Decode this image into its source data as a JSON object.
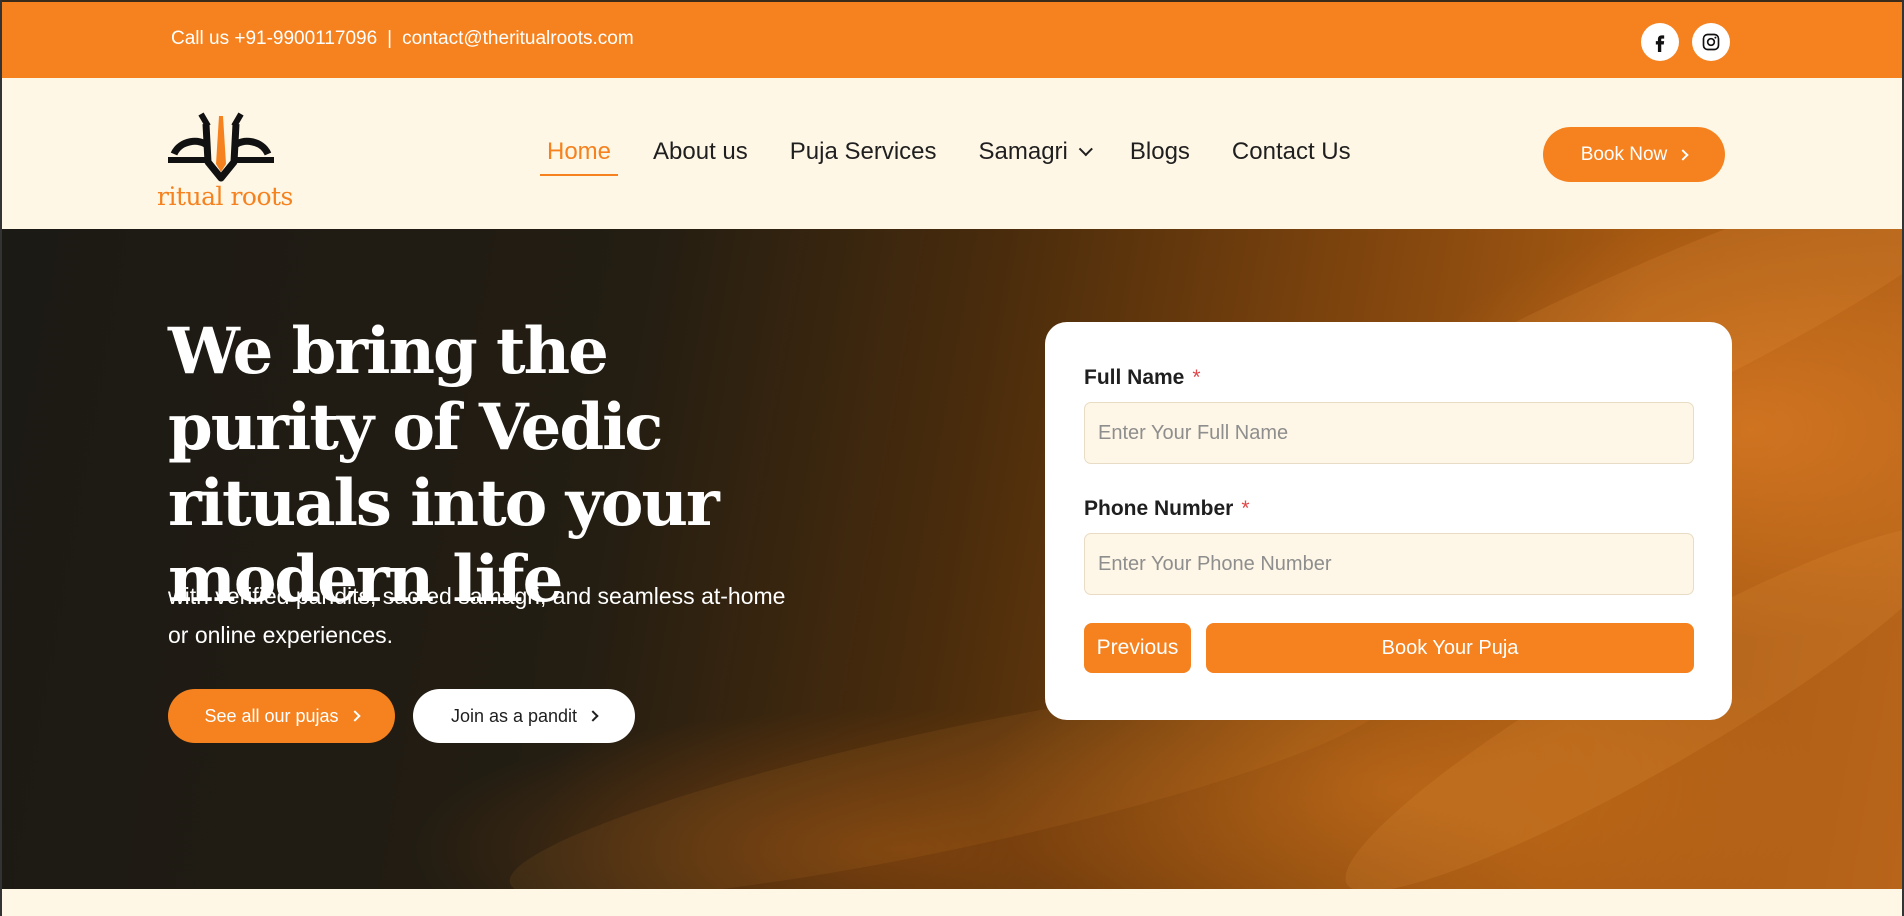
{
  "topbar": {
    "phone_text": "Call us +91-9900117096",
    "separator": "|",
    "email_text": "contact@theritualroots.com",
    "social_icons": [
      "facebook-icon",
      "instagram-icon"
    ]
  },
  "header": {
    "logo_text": "ritual roots",
    "nav": [
      {
        "label": "Home",
        "active": true
      },
      {
        "label": "About us",
        "active": false
      },
      {
        "label": "Puja Services",
        "active": false
      },
      {
        "label": "Samagri",
        "active": false,
        "has_dropdown": true
      },
      {
        "label": "Blogs",
        "active": false
      },
      {
        "label": "Contact Us",
        "active": false
      }
    ],
    "cta_label": "Book Now"
  },
  "hero": {
    "headline": "We bring the purity of Vedic rituals into your modern life",
    "subtext": "with verified pandits, sacred samagri, and seamless at-home or online experiences.",
    "primary_button": "See all our pujas",
    "secondary_button": "Join as a pandit"
  },
  "form": {
    "name_label": "Full Name",
    "name_placeholder": "Enter Your Full Name",
    "name_value": "",
    "phone_label": "Phone Number",
    "phone_placeholder": "Enter Your Phone Number",
    "phone_value": "",
    "required_mark": "*",
    "previous_label": "Previous",
    "submit_label": "Book Your Puja"
  },
  "colors": {
    "accent": "#f5821f",
    "cream": "#fff7e6",
    "dark": "#1f1f1f",
    "required": "#e0484a"
  }
}
